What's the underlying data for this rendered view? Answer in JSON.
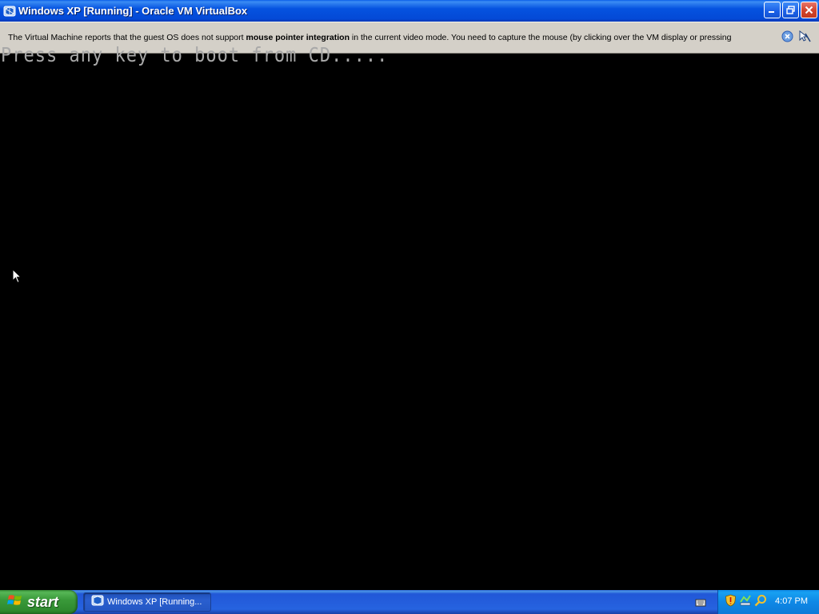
{
  "window": {
    "title": "Windows XP [Running] - Oracle VM VirtualBox",
    "icons": [
      "virtualbox-icon",
      "minimize-icon",
      "restore-icon",
      "close-icon"
    ]
  },
  "notification": {
    "text_before": "The Virtual Machine reports that the guest OS does not support ",
    "text_bold": "mouse pointer integration",
    "text_after": " in the current video mode. You need to capture the mouse (by clicking over the VM display or pressing",
    "icons": [
      "dismiss-icon",
      "mouse-integration-icon"
    ]
  },
  "vm": {
    "boot_message": "Press any key to boot from CD....."
  },
  "taskbar": {
    "start_label": "start",
    "task_item_label": "Windows XP [Running...",
    "clock": "4:07 PM",
    "tray_icons": [
      "keyboard-icon",
      "security-shield-icon",
      "network-icon",
      "search-icon"
    ]
  },
  "colors": {
    "titlebar": "#0553e0",
    "notification_bg": "#d4d0c8",
    "start_green": "#3a9a3a",
    "taskbar_blue": "#2663e0",
    "tray_blue": "#0e88e6",
    "boot_text": "#a8a8a8"
  }
}
